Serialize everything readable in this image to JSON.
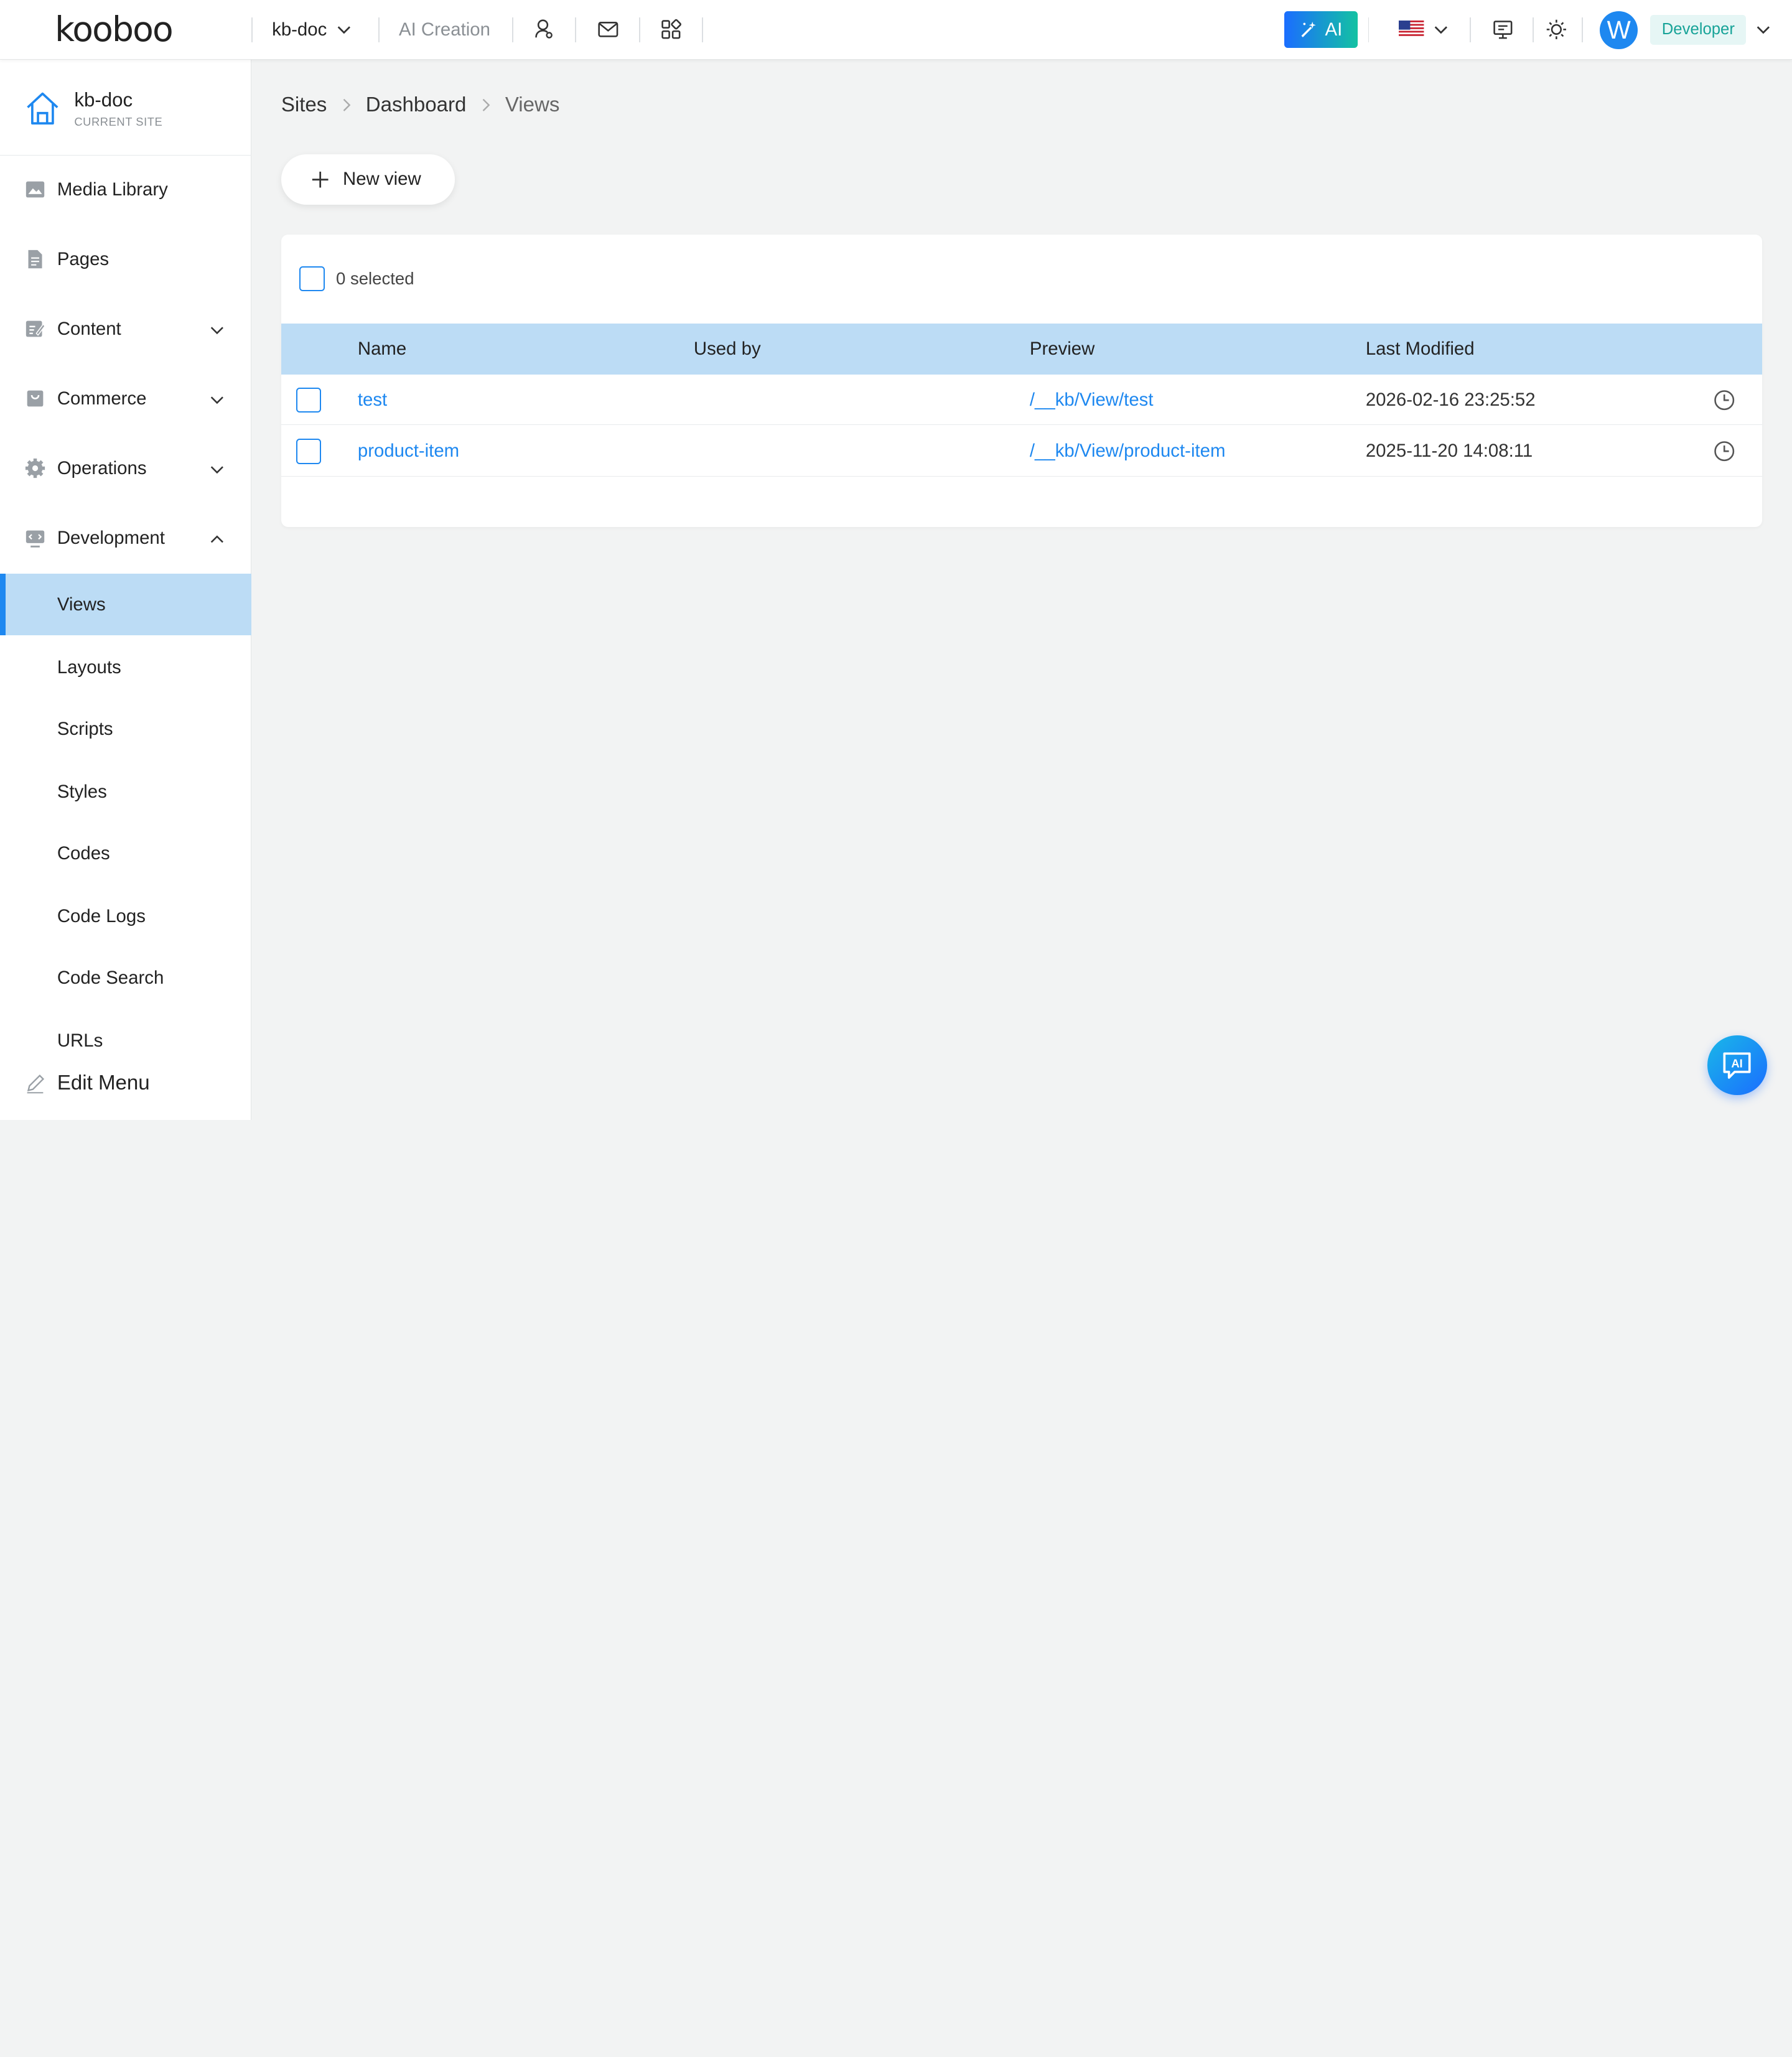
{
  "brand": {
    "logo_text": "kooboo"
  },
  "topbar": {
    "site_switch": "kb-doc",
    "ai_creation": "AI Creation",
    "ai_button": "AI",
    "avatar_letter": "W",
    "role": "Developer",
    "icons": [
      "users-icon",
      "mail-icon",
      "apps-grid-icon",
      "monitor-icon",
      "theme-sun-icon"
    ]
  },
  "sidebar": {
    "site_name": "kb-doc",
    "site_sub": "CURRENT SITE",
    "items": [
      {
        "label": "Media Library",
        "icon": "image-icon"
      },
      {
        "label": "Pages",
        "icon": "page-icon"
      },
      {
        "label": "Content",
        "icon": "content-icon",
        "expandable": true
      },
      {
        "label": "Commerce",
        "icon": "store-icon",
        "expandable": true
      },
      {
        "label": "Operations",
        "icon": "gear-icon",
        "expandable": true
      },
      {
        "label": "Development",
        "icon": "code-icon",
        "expanded": true
      }
    ],
    "sub_items": [
      {
        "label": "Views",
        "active": true
      },
      {
        "label": "Layouts"
      },
      {
        "label": "Scripts"
      },
      {
        "label": "Styles"
      },
      {
        "label": "Codes"
      },
      {
        "label": "Code Logs"
      },
      {
        "label": "Code Search"
      },
      {
        "label": "URLs"
      }
    ],
    "edit_menu": "Edit Menu"
  },
  "breadcrumb": [
    "Sites",
    "Dashboard",
    "Views"
  ],
  "main": {
    "new_view_label": "New view",
    "selected_text": "0 selected",
    "columns": [
      "Name",
      "Used by",
      "Preview",
      "Last Modified"
    ],
    "rows": [
      {
        "name": "test",
        "used_by": "",
        "preview": "/__kb/View/test",
        "modified": "2026-02-16 23:25:52"
      },
      {
        "name": "product-item",
        "used_by": "",
        "preview": "/__kb/View/product-item",
        "modified": "2025-11-20 14:08:11"
      }
    ]
  },
  "floating": {
    "ai_chat": "AI"
  },
  "colors": {
    "accent": "#1e88f0",
    "active_bg": "#bcdcf5",
    "role_text": "#17a398"
  }
}
